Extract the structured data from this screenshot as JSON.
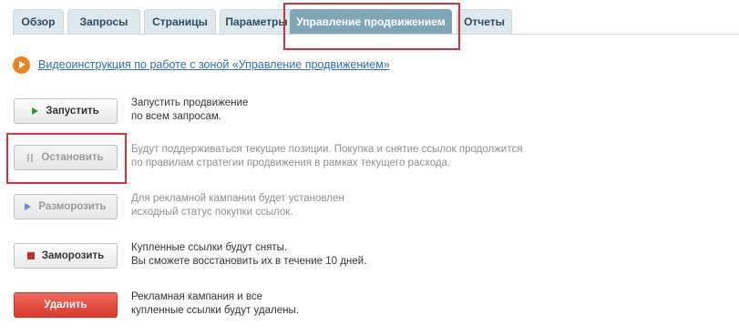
{
  "tabs": [
    {
      "label": "Обзор"
    },
    {
      "label": "Запросы"
    },
    {
      "label": "Страницы"
    },
    {
      "label": "Параметры"
    },
    {
      "label": "Управление продвижением",
      "active": true
    },
    {
      "label": "Отчеты"
    }
  ],
  "video": {
    "icon": "play-icon",
    "link_text": "Видеоинструкция по работе с зоной «Управление продвижением»"
  },
  "actions": [
    {
      "id": "start",
      "label": "Запустить",
      "icon": "play-green-icon",
      "enabled": true,
      "description": [
        "Запустить продвижение",
        "по всем запросам."
      ]
    },
    {
      "id": "stop",
      "label": "Остановить",
      "icon": "pause-icon",
      "enabled": false,
      "description": [
        "Будут поддерживаться текущие позиции. Покупка и снятие ссылок продолжится",
        "по правилам стратегии продвижения в рамках текущего расхода."
      ]
    },
    {
      "id": "unfreeze",
      "label": "Разморозить",
      "icon": "play-blue-icon",
      "enabled": true,
      "description": [
        "Для рекламной кампании будет установлен",
        "исходный статус покупки ссылок."
      ]
    },
    {
      "id": "freeze",
      "label": "Заморозить",
      "icon": "stop-red-icon",
      "enabled": true,
      "description": [
        "Купленные ссылки будут сняты.",
        "Вы сможете восстановить их в течение 10 дней."
      ]
    },
    {
      "id": "delete",
      "label": "Удалить",
      "icon": "",
      "enabled": true,
      "description": [
        "Рекламная кампания и все",
        "купленные ссылки будут удалены."
      ]
    }
  ],
  "colors": {
    "tab_bg": "#dde8ed",
    "tab_active_bg": "#7fa6b4",
    "highlight": "#d2303a",
    "link": "#2a6fae",
    "danger": "#d8392c"
  }
}
